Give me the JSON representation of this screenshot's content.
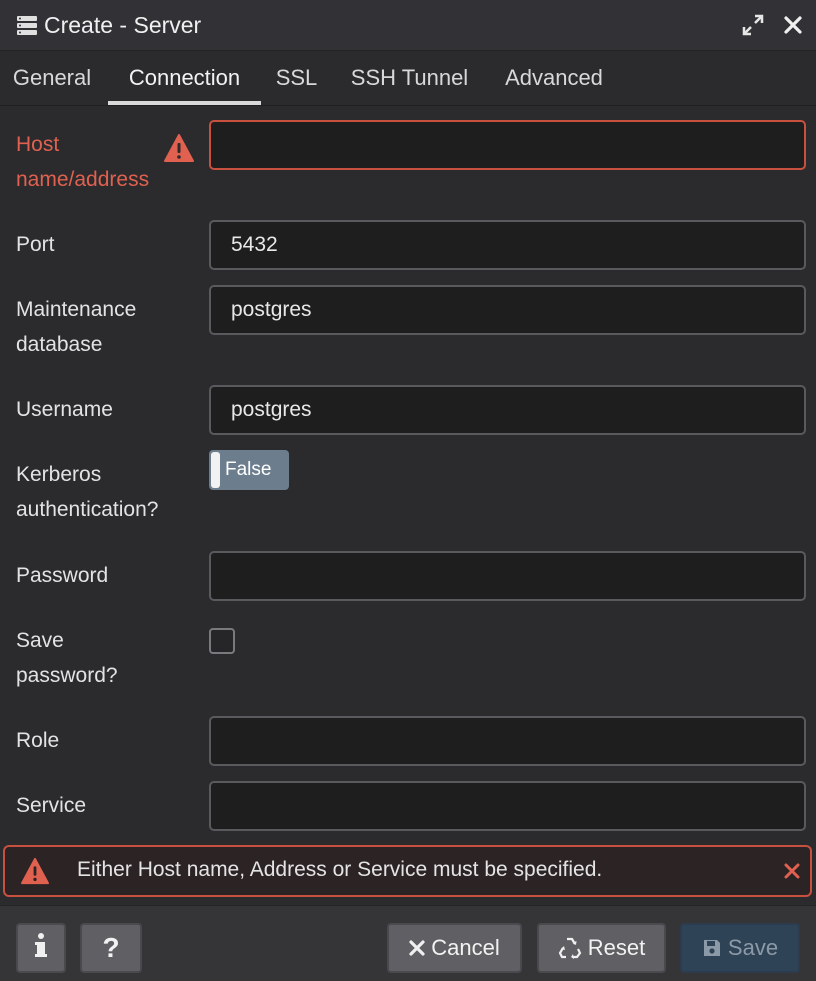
{
  "window": {
    "title": "Create - Server"
  },
  "tabs": [
    {
      "label": "General"
    },
    {
      "label": "Connection"
    },
    {
      "label": "SSL"
    },
    {
      "label": "SSH Tunnel"
    },
    {
      "label": "Advanced"
    }
  ],
  "active_tab": "Connection",
  "form": {
    "host_label_line1": "Host",
    "host_label_line2": "name/address",
    "host_value": "",
    "port_label": "Port",
    "port_value": "5432",
    "maintenance_label_line1": "Maintenance",
    "maintenance_label_line2": "database",
    "maintenance_value": "postgres",
    "username_label": "Username",
    "username_value": "postgres",
    "kerberos_label_line1": "Kerberos",
    "kerberos_label_line2": "authentication?",
    "kerberos_value": "False",
    "password_label": "Password",
    "password_value": "",
    "save_password_label_line1": "Save",
    "save_password_label_line2": "password?",
    "save_password_checked": false,
    "role_label": "Role",
    "role_value": "",
    "service_label": "Service",
    "service_value": ""
  },
  "error_banner": {
    "message": "Either Host name, Address or Service must be specified."
  },
  "footer": {
    "cancel_label": "Cancel",
    "reset_label": "Reset",
    "save_label": "Save"
  },
  "colors": {
    "error": "#e0614f",
    "background": "#2b2b2e",
    "toggle": "#6c7d8e",
    "save_button": "#2f4357"
  }
}
